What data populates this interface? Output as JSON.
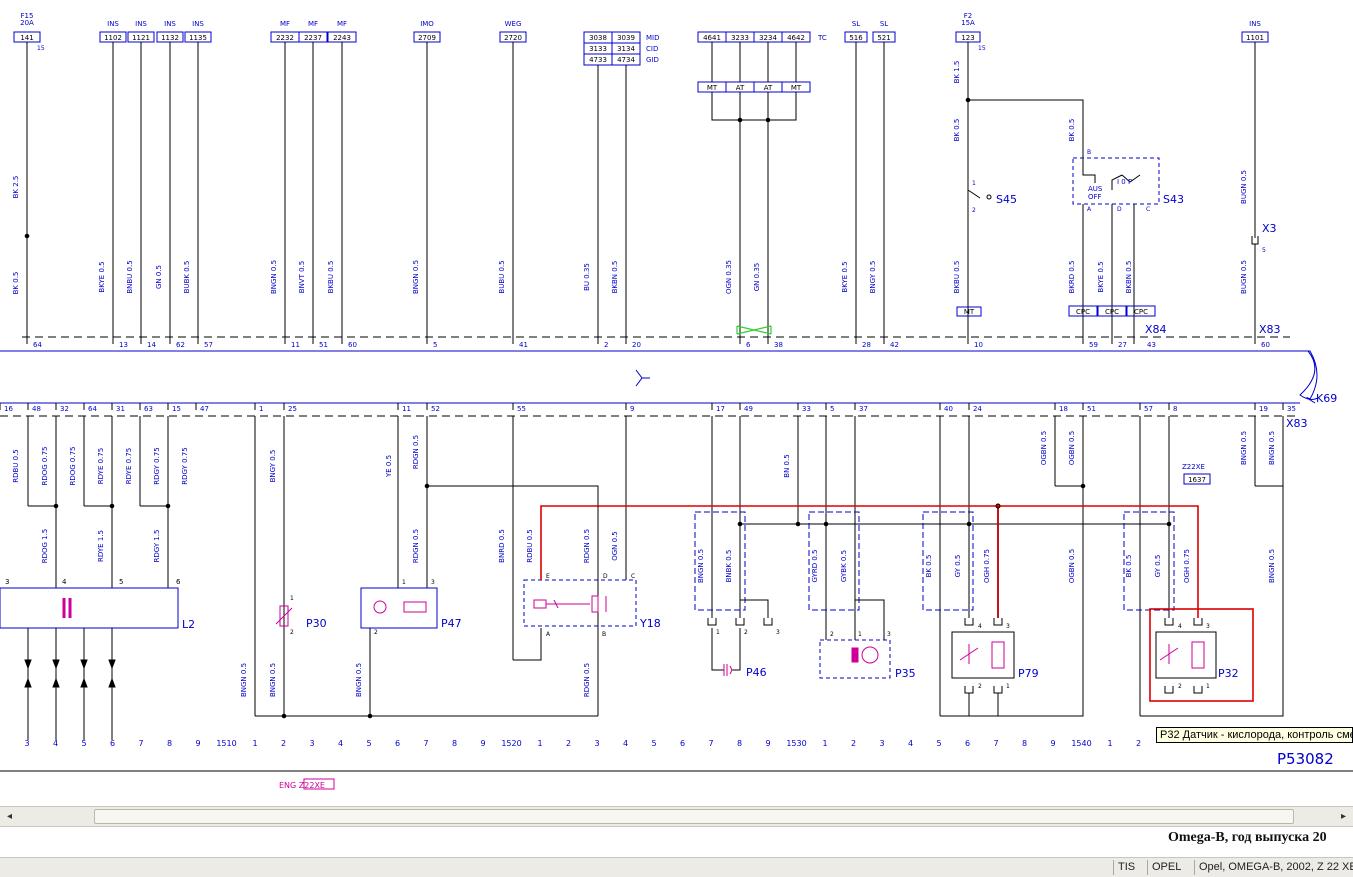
{
  "colors": {
    "wire": "#000000",
    "label": "#0000cc",
    "component": "#cc0099",
    "highlight": "#dd0000",
    "diag_bg": "#ffffff"
  },
  "top_fuse": {
    "name": "F15",
    "rating": "20A",
    "code": "141",
    "pin": "15"
  },
  "top_refs": [
    {
      "tag": "INS",
      "code": "1102"
    },
    {
      "tag": "INS",
      "code": "1121"
    },
    {
      "tag": "INS",
      "code": "1132"
    },
    {
      "tag": "INS",
      "code": "1135"
    },
    {
      "tag": "MF",
      "code": "2232"
    },
    {
      "tag": "MF",
      "code": "2237"
    },
    {
      "tag": "MF",
      "code": "2243"
    },
    {
      "tag": "IMO",
      "code": "2709"
    },
    {
      "tag": "WEG",
      "code": "2720"
    },
    {
      "tag": "SL",
      "code": "516"
    },
    {
      "tag": "SL",
      "code": "521"
    },
    {
      "tag": "INS",
      "code": "1101"
    }
  ],
  "mid_table": {
    "rows": [
      [
        "3038",
        "3039",
        "MID"
      ],
      [
        "3133",
        "3134",
        "CID"
      ],
      [
        "4733",
        "4734",
        "GID"
      ]
    ]
  },
  "tc_table": {
    "codes": [
      "4641",
      "3233",
      "3234",
      "4642"
    ],
    "tag": "TC",
    "modes": [
      "MT",
      "AT",
      "AT",
      "MT"
    ]
  },
  "fuse_f2": {
    "name": "F2",
    "rating": "15A",
    "code": "123",
    "pin": "15"
  },
  "upper_wires": {
    "bk25": "BK 2.5",
    "bk05_a": "BK 0.5",
    "bkye05": "BKYE 0.5",
    "bnbu05": "BNBU 0.5",
    "gn05": "GN 0.5",
    "bubk05": "BUBK 0.5",
    "bngn05_a": "BNGN 0.5",
    "bnvt05": "BNVT 0.5",
    "bkbu05": "BKBU 0.5",
    "bngn05_b": "BNGN 0.5",
    "bubu05": "BUBU 0.5",
    "bu035": "BU 0.35",
    "bkbn05": "BKBN 0.5",
    "ogn035": "OGN 0.35",
    "gn035": "GN 0.35",
    "bkye05_b": "BKYE 0.5",
    "bngy05": "BNGY 0.5",
    "bk15": "BK 1.5",
    "bk05_b": "BK 0.5",
    "bk05_c": "BK 0.5",
    "bkbu05_b": "BKBU 0.5",
    "bkrd05": "BKRD 0.5",
    "bkye05_c": "BKYE 0.5",
    "bkbn05_b": "BKBN 0.5",
    "bugn05": "BUGN 0.5",
    "bugn05_b": "BUGN 0.5"
  },
  "top_pins": [
    "64",
    "13",
    "14",
    "62",
    "57",
    "11",
    "51",
    "60",
    "5",
    "41",
    "2",
    "20",
    "6",
    "38",
    "28",
    "42",
    "10",
    "59",
    "27",
    "43",
    "60"
  ],
  "bottom_pins": [
    "16",
    "48",
    "32",
    "64",
    "31",
    "63",
    "15",
    "47",
    "1",
    "25",
    "11",
    "52",
    "55",
    "9",
    "17",
    "49",
    "33",
    "5",
    "37",
    "40",
    "24",
    "18",
    "51",
    "57",
    "8",
    "19",
    "35"
  ],
  "switches": {
    "s45": "S45",
    "s45_p1": "1",
    "s45_p2": "2",
    "s43": "S43",
    "s43_b": "B",
    "s43_a": "A",
    "s43_d": "D",
    "s43_c": "C",
    "s43_aus": "AUS",
    "s43_off": "OFF",
    "s43_io": "I 0 P",
    "mt": "MT",
    "cpc": "CPC"
  },
  "connectors": {
    "x84": "X84",
    "x83_top": "X83",
    "x3": "X3",
    "x3_pin": "5",
    "k69": "K69",
    "x83_bottom": "X83",
    "z22xe": "Z22XE",
    "z22xe_code": "1637"
  },
  "lower_wires": {
    "w1": "RDBU 0.5",
    "w2": "RDOG 0.75",
    "w3": "RDOG 0.75",
    "w4": "RDYE 0.75",
    "w5": "RDYE 0.75",
    "w6": "RDGY 0.75",
    "w7": "RDGY 0.75",
    "w8": "RDOG 1.5",
    "w9": "RDYE 1.5",
    "w10": "RDGY 1.5",
    "w11": "BNGY 0.5",
    "w12": "YE 0.5",
    "w13": "RDGN 0.5",
    "w14": "RDGN 0.5",
    "w15": "BNRD 0.5",
    "w16": "RDBU 0.5",
    "w17": "RDGN 0.5",
    "w18": "OGN 0.5",
    "w19": "BNGN 0.5",
    "w20": "BNBK 0.5",
    "w21": "BN 0.5",
    "w22": "GYRD 0.5",
    "w23": "GYBK 0.5",
    "w24": "BK 0.5",
    "w25": "GY 0.5",
    "w26": "OGH 0.75",
    "w27": "OGBN 0.5",
    "w28": "OGBN 0.5",
    "w29": "OGBN 0.5",
    "w30": "BK 0.5",
    "w31": "GY 0.5",
    "w32": "OGH 0.75",
    "w33": "BNGN 0.5",
    "w34": "BNGN 0.5",
    "w35": "BNGN 0.5",
    "w36": "BNGN 0.5",
    "w37": "BNGN 0.5",
    "w38": "BNGN 0.5"
  },
  "components": {
    "l2": "L2",
    "l2_pins": [
      "3",
      "4",
      "5",
      "6"
    ],
    "p30": "P30",
    "p30_p1": "1",
    "p30_p2": "2",
    "p47": "P47",
    "p47_p1": "1",
    "p47_p2": "2",
    "p47_p3": "3",
    "y18": "Y18",
    "y18_pins": [
      "E",
      "D",
      "C",
      "A",
      "B"
    ],
    "p46": "P46",
    "p46_pins": [
      "1",
      "2",
      "3"
    ],
    "p35": "P35",
    "p35_pins": [
      "2",
      "1",
      "3"
    ],
    "p79": "P79",
    "p79_pins": [
      "4",
      "3",
      "2",
      "1"
    ],
    "p32": "P32",
    "p32_pins": [
      "4",
      "3",
      "2",
      "1"
    ]
  },
  "ruler": [
    "3",
    "4",
    "5",
    "6",
    "7",
    "8",
    "9",
    "1510",
    "1",
    "2",
    "3",
    "4",
    "5",
    "6",
    "7",
    "8",
    "9",
    "1520",
    "1",
    "2",
    "3",
    "4",
    "5",
    "6",
    "7",
    "8",
    "9",
    "1530",
    "1",
    "2",
    "3",
    "4",
    "5",
    "6",
    "7",
    "8",
    "9",
    "1540",
    "1",
    "2"
  ],
  "page_code": "P53082",
  "eng_tag": "ENG Z22XE",
  "tooltip": "P32 Датчик - кислорода, контроль сме",
  "caption": "Omega-B, год выпуска 20",
  "scrollbar": {
    "left": "◂",
    "right": "▸"
  },
  "statusbar": {
    "app": "TIS",
    "brand": "OPEL",
    "vehicle": "Opel, OMEGA-B, 2002, Z 22 XE"
  }
}
